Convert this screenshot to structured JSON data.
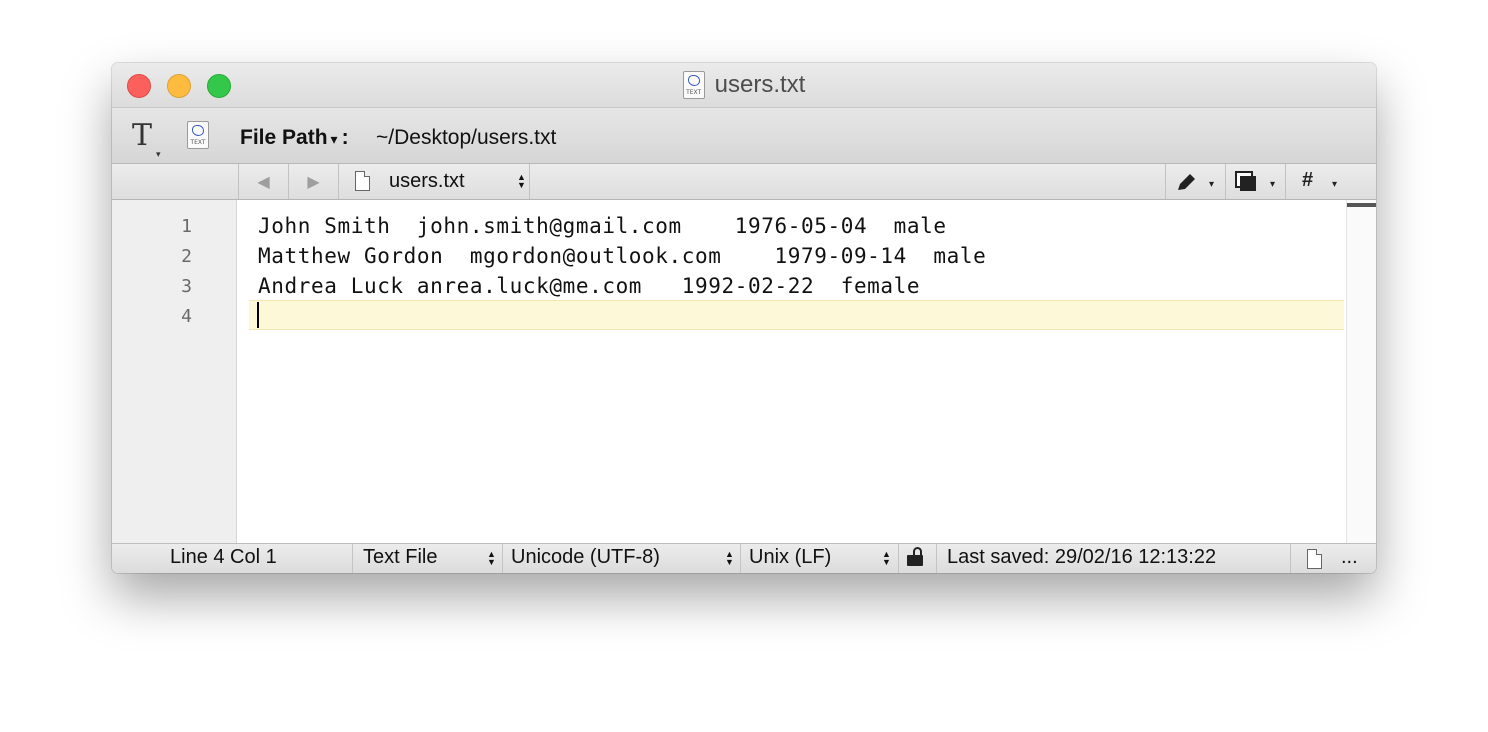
{
  "window": {
    "title": "users.txt",
    "doc_icon_label": "TEXT"
  },
  "toolbar": {
    "font_icon": "T",
    "path_label": "File Path",
    "path_caret": "▾",
    "path_separator": ":",
    "path_value": "~/Desktop/users.txt"
  },
  "navbar": {
    "back_glyph": "◀",
    "forward_glyph": "▶",
    "file_name": "users.txt",
    "marker_glyph": "#"
  },
  "editor": {
    "line_numbers": [
      "1",
      "2",
      "3",
      "4"
    ],
    "lines": [
      "John Smith  john.smith@gmail.com    1976-05-04  male",
      "Matthew Gordon  mgordon@outlook.com    1979-09-14  male",
      "Andrea Luck anrea.luck@me.com   1992-02-22  female",
      ""
    ],
    "current_line": 4
  },
  "statusbar": {
    "position": "Line 4 Col 1",
    "file_type": "Text File",
    "encoding": "Unicode (UTF-8)",
    "line_endings": "Unix (LF)",
    "last_saved": "Last saved: 29/02/16 12:13:22",
    "more": "..."
  }
}
